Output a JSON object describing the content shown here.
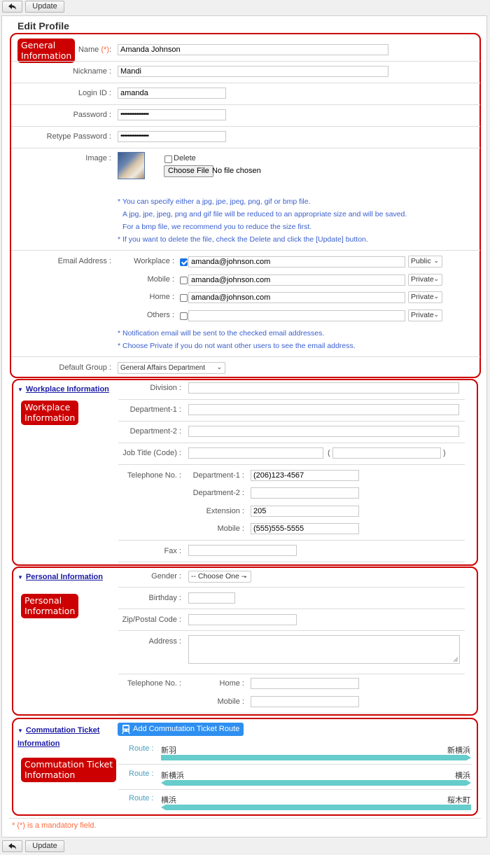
{
  "toolbar": {
    "back_icon": "back-arrow-icon",
    "update_label": "Update"
  },
  "page_title": "Edit Profile",
  "general": {
    "tag": "General\nInformation",
    "name_label": "Name",
    "required_mark": "(*)",
    "name_value": "Amanda Johnson",
    "nickname_label": "Nickname",
    "nickname_value": "Mandi",
    "login_label": "Login ID",
    "login_value": "amanda",
    "password_label": "Password",
    "password_value": "••••••••••••••••",
    "retype_label": "Retype Password",
    "retype_value": "••••••••••••••••",
    "image_label": "Image",
    "delete_label": "Delete",
    "choose_file_label": "Choose File",
    "no_file_label": "No file chosen",
    "image_notes": [
      "* You can specify either a jpg, jpe, jpeg, png, gif or bmp file.",
      "A jpg, jpe, jpeg, png and gif file will be reduced to an appropriate size and will be saved.",
      "For a bmp file, we recommend you to reduce the size first.",
      "* If you want to delete the file, check the Delete and click the [Update] button."
    ],
    "email_label": "Email Address",
    "emails": [
      {
        "label": "Workplace",
        "checked": true,
        "value": "amanda@johnson.com",
        "visibility": "Public"
      },
      {
        "label": "Mobile",
        "checked": false,
        "value": "amanda@johnson.com",
        "visibility": "Private"
      },
      {
        "label": "Home",
        "checked": false,
        "value": "amanda@johnson.com",
        "visibility": "Private"
      },
      {
        "label": "Others",
        "checked": false,
        "value": "",
        "visibility": "Private"
      }
    ],
    "email_notes": [
      "* Notification email will be sent to the checked email addresses.",
      "* Choose Private if you do not want other users to see the email address."
    ],
    "default_group_label": "Default Group",
    "default_group_value": "General Affairs Department"
  },
  "workplace": {
    "link": "Workplace Information",
    "tag": "Workplace\nInformation",
    "division_label": "Division",
    "dept1_label": "Department-1",
    "dept2_label": "Department-2",
    "job_title_label": "Job Title (Code)",
    "paren_open": "(",
    "paren_close": ")",
    "telephone_label": "Telephone No.",
    "phones": [
      {
        "label": "Department-1",
        "value": "(206)123-4567"
      },
      {
        "label": "Department-2",
        "value": ""
      },
      {
        "label": "Extension",
        "value": "205"
      },
      {
        "label": "Mobile",
        "value": "(555)555-5555"
      }
    ],
    "fax_label": "Fax"
  },
  "personal": {
    "link": "Personal Information",
    "tag": "Personal\nInformation",
    "gender_label": "Gender",
    "gender_value": "-- Choose One --",
    "birthday_label": "Birthday",
    "zip_label": "Zip/Postal Code",
    "address_label": "Address",
    "telephone_label": "Telephone No.",
    "phones": [
      {
        "label": "Home",
        "value": ""
      },
      {
        "label": "Mobile",
        "value": ""
      }
    ]
  },
  "commutation": {
    "link_line1": "Commutation Ticket",
    "link_line2": "Information",
    "tag": "Commutation Ticket\nInformation",
    "add_button": "Add Commutation Ticket Route",
    "route_label": "Route",
    "routes": [
      {
        "from": "新羽",
        "to": "新横浜"
      },
      {
        "from": "新横浜",
        "to": "横浜"
      },
      {
        "from": "横浜",
        "to": "桜木町"
      }
    ]
  },
  "mandatory_note": "* (*) is a mandatory field."
}
